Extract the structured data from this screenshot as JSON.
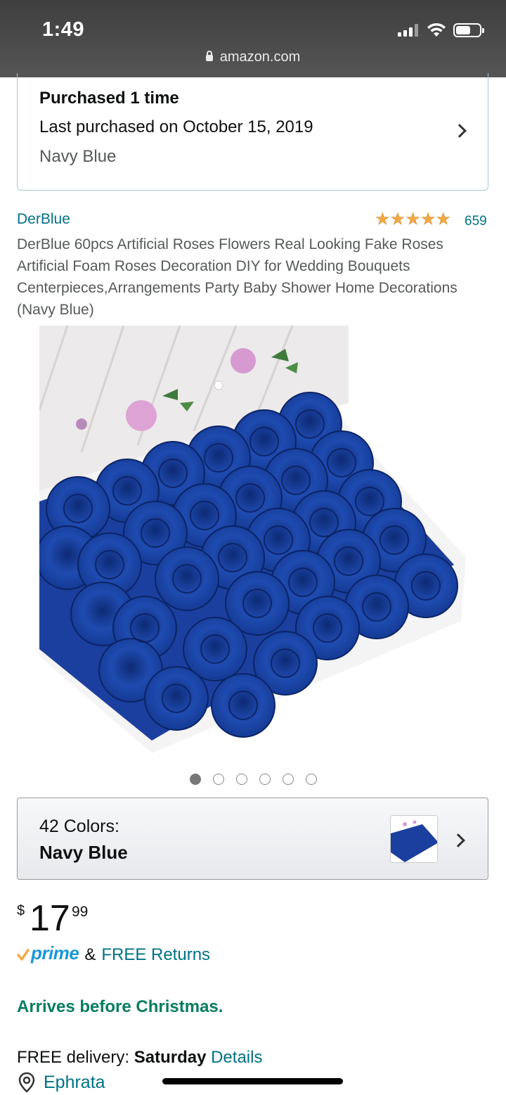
{
  "status_bar": {
    "time": "1:49",
    "url": "amazon.com"
  },
  "purchase": {
    "title": "Purchased 1 time",
    "last_purchased": "Last purchased on October 15, 2019",
    "color": "Navy Blue"
  },
  "product": {
    "brand": "DerBlue",
    "rating_stars": 5,
    "rating_count": "659",
    "title": "DerBlue 60pcs Artificial Roses Flowers Real Looking Fake Roses Artificial Foam Roses Decoration DIY for Wedding Bouquets Centerpieces,Arrangements Party Baby Shower Home Decorations (Navy Blue)",
    "image_count": 6,
    "image_active_index": 0
  },
  "color_selector": {
    "count_label": "42 Colors:",
    "selected": "Navy Blue"
  },
  "price": {
    "currency": "$",
    "whole": "17",
    "fraction": "99"
  },
  "prime": {
    "label": "prime",
    "amp": "&",
    "returns": "FREE Returns"
  },
  "arrives": "Arrives before Christmas.",
  "delivery": {
    "prefix": "FREE delivery:",
    "day": "Saturday",
    "details_link": "Details"
  },
  "location": "Ephrata",
  "colors": {
    "link": "#007185",
    "green": "#067d62",
    "star": "#f3a847",
    "navy_rose": "#1b3f9e"
  }
}
